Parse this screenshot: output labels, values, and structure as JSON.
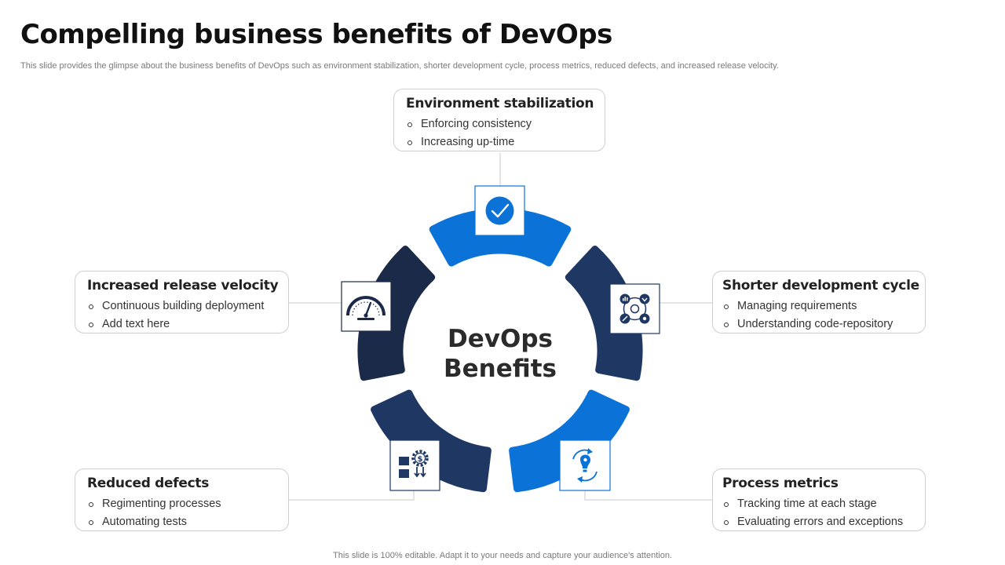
{
  "title": "Compelling business benefits of DevOps",
  "subtitle": "This slide provides the glimpse about the business benefits of DevOps such as environment stabilization, shorter development cycle, process metrics, reduced defects, and increased release velocity.",
  "center": {
    "line1": "DevOps",
    "line2": "Benefits"
  },
  "colors": {
    "bright_blue": "#0b72d8",
    "navy": "#1f3863",
    "dark_navy": "#1b2a48",
    "connector": "#c8c8c8",
    "card_border": "#cfcfcf"
  },
  "benefits": [
    {
      "title": "Environment stabilization",
      "items": [
        "Enforcing consistency",
        "Increasing up-time"
      ],
      "icon": "checkmark-icon",
      "segment_color": "#0b72d8"
    },
    {
      "title": "Shorter development cycle",
      "items": [
        "Managing requirements",
        "Understanding code-repository"
      ],
      "icon": "workflow-cycle-icon",
      "segment_color": "#1f3863"
    },
    {
      "title": "Process metrics",
      "items": [
        "Tracking time at each stage",
        "Evaluating errors and exceptions"
      ],
      "icon": "idea-cycle-icon",
      "segment_color": "#0b72d8"
    },
    {
      "title": "Reduced defects",
      "items": [
        "Regimenting processes",
        "Automating tests"
      ],
      "icon": "cost-gear-icon",
      "segment_color": "#1f3863"
    },
    {
      "title": "Increased release velocity",
      "items": [
        "Continuous building deployment",
        "Add text here"
      ],
      "icon": "speedometer-icon",
      "segment_color": "#1b2a48"
    }
  ],
  "footer": "This slide is 100% editable. Adapt it to your needs and capture your audience's attention."
}
